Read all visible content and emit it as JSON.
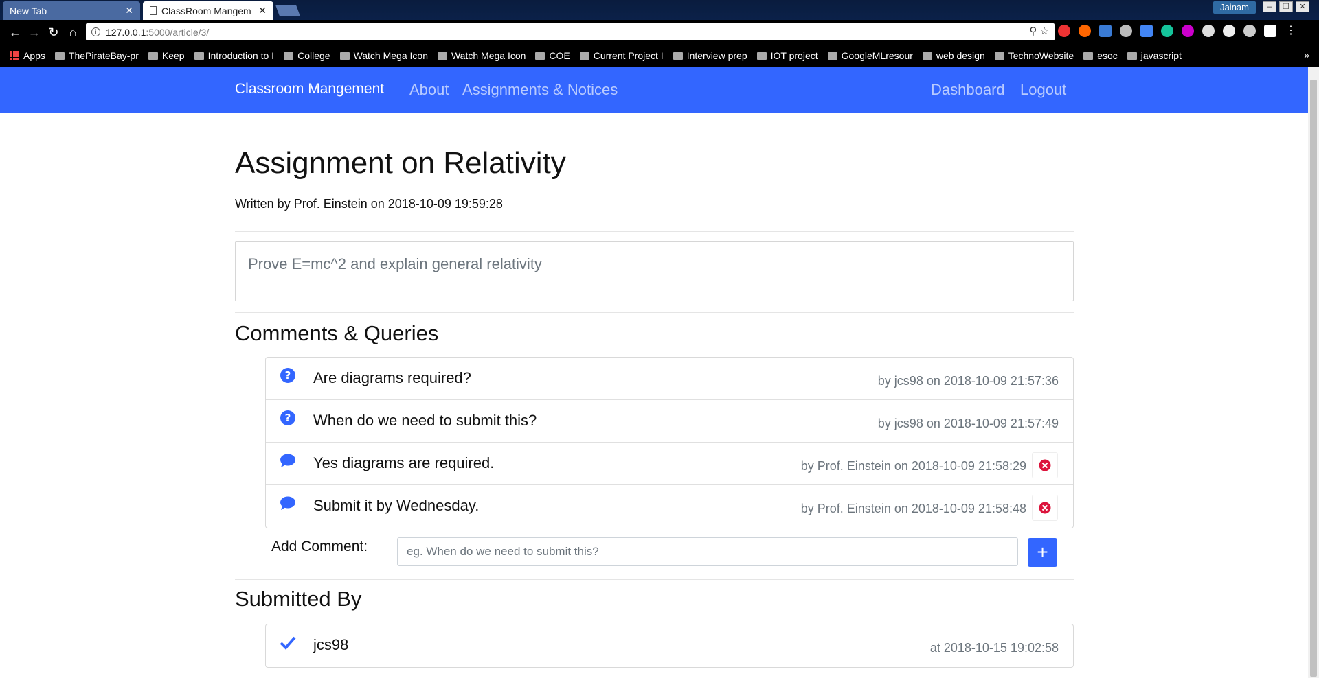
{
  "browser": {
    "tabs": [
      {
        "title": "New Tab",
        "active": false
      },
      {
        "title": "ClassRoom Mangem",
        "active": true
      }
    ],
    "profile_name": "Jainam",
    "url_host": "127.0.0.1",
    "url_path": ":5000/article/3/",
    "bookmarks": [
      "Apps",
      "ThePirateBay-pr",
      "Keep",
      "Introduction to I",
      "College",
      "Watch Mega Icon",
      "Watch Mega Icon",
      "COE",
      "Current Project I",
      "Interview prep",
      "IOT project",
      "GoogleMLresour",
      "web design",
      "TechnoWebsite",
      "esoc",
      "javascript"
    ],
    "bookmarks_more": "»"
  },
  "navbar": {
    "brand": "Classroom Mangement",
    "links": [
      "About",
      "Assignments & Notices"
    ],
    "right_links": [
      "Dashboard",
      "Logout"
    ],
    "color": "#3366ff"
  },
  "article": {
    "title": "Assignment on Relativity",
    "byline": "Written by Prof. Einstein on 2018-10-09 19:59:28",
    "body": "Prove E=mc^2 and explain general relativity"
  },
  "comments": {
    "heading": "Comments & Queries",
    "items": [
      {
        "icon": "question-icon",
        "text": "Are diagrams required?",
        "meta": "by jcs98 on 2018-10-09 21:57:36",
        "deletable": false
      },
      {
        "icon": "question-icon",
        "text": "When do we need to submit this?",
        "meta": "by jcs98 on 2018-10-09 21:57:49",
        "deletable": false
      },
      {
        "icon": "comment-icon",
        "text": "Yes diagrams are required.",
        "meta": "by Prof. Einstein on 2018-10-09 21:58:29",
        "deletable": true
      },
      {
        "icon": "comment-icon",
        "text": "Submit it by Wednesday.",
        "meta": "by Prof. Einstein on 2018-10-09 21:58:48",
        "deletable": true
      }
    ],
    "add_label": "Add Comment:",
    "add_placeholder": "eg. When do we need to submit this?",
    "add_button": "+"
  },
  "submissions": {
    "heading": "Submitted By",
    "items": [
      {
        "icon": "check-icon",
        "user": "jcs98",
        "meta": "at 2018-10-15 19:02:58"
      }
    ]
  }
}
